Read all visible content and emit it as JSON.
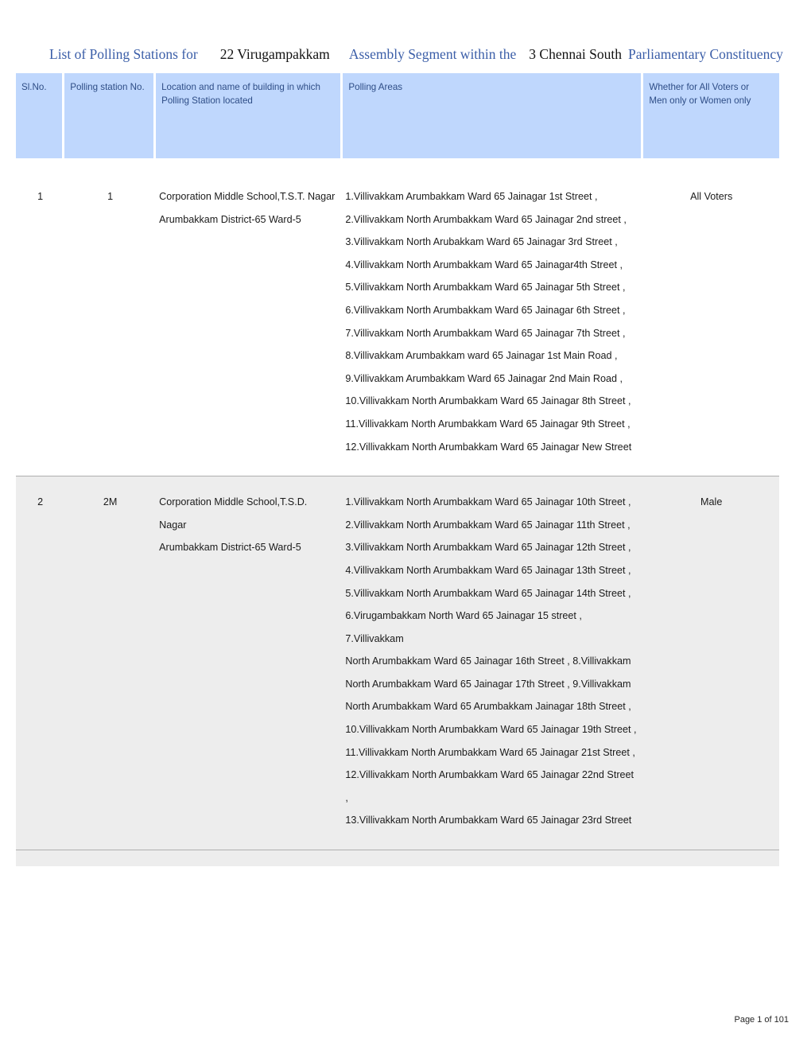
{
  "document": {
    "title_parts": [
      {
        "text": "List of Polling Stations for",
        "color": "#3B5EA8"
      },
      {
        "text": "22 Virugampakkam",
        "color": "#121212"
      },
      {
        "text": "Assembly Segment within the",
        "color": "#3B5EA8"
      },
      {
        "text": "3 Chennai South",
        "color": "#121212"
      },
      {
        "text": "Parliamentary Constituency",
        "color": "#3B5EA8"
      }
    ],
    "title_segment_1": "List of Polling Stations for",
    "title_segment_2": "22 Virugampakkam",
    "title_segment_3": "Assembly Segment within the",
    "title_segment_4": "3 Chennai South",
    "title_segment_5": "Parliamentary Constituency",
    "footer": "Page 1 of 101",
    "colors": {
      "header_background": "#BFD7FD",
      "header_text": "#2E4D86",
      "title_accent": "#3B5EA8",
      "alt_row_background": "#EDEDED",
      "separator": "#AFAFAF"
    }
  },
  "table": {
    "columns": [
      {
        "key": "sl_no",
        "label": "Sl.No."
      },
      {
        "key": "station_no",
        "label": "Polling station No."
      },
      {
        "key": "location",
        "label": "Location and name of building in which Polling Station located"
      },
      {
        "key": "polling_areas",
        "label": "Polling Areas"
      },
      {
        "key": "voters",
        "label": "Whether for All Voters or Men only or Women only"
      }
    ],
    "column_header_lines": {
      "sl_no": [
        "Sl.No."
      ],
      "station_no": [
        "Polling station No."
      ],
      "location": [
        "Location and name of building in which",
        "Polling Station located"
      ],
      "polling_areas": [
        "Polling Areas"
      ],
      "voters": [
        "Whether for All Voters or",
        "Men only or Women only"
      ]
    },
    "rows": [
      {
        "sl_no": "1",
        "station_no": "1",
        "location_lines": [
          "Corporation Middle School,T.S.T. Nagar",
          "Arumbakkam District-65 Ward-5"
        ],
        "polling_area_lines": [
          "1.Villivakkam Arumbakkam Ward 65 Jainagar 1st Street ,",
          "2.Villivakkam North Arumbakkam Ward 65 Jainagar 2nd street ,",
          "3.Villivakkam North Arubakkam Ward 65 Jainagar 3rd Street ,",
          "4.Villivakkam North Arumbakkam Ward 65 Jainagar4th Street ,",
          "5.Villivakkam North Arumbakkam Ward 65 Jainagar 5th Street ,",
          "6.Villivakkam North Arumbakkam Ward 65 Jainagar 6th Street ,",
          "7.Villivakkam North Arumbakkam Ward 65 Jainagar 7th Street ,",
          "8.Villivakkam Arumbakkam ward 65 Jainagar 1st Main Road ,",
          "9.Villivakkam Arumbakkam Ward 65 Jainagar 2nd Main Road ,",
          "10.Villivakkam North Arumbakkam Ward 65 Jainagar 8th Street ,",
          "11.Villivakkam North Arumbakkam Ward 65 Jainagar 9th Street ,",
          "12.Villivakkam North Arumbakkam Ward 65 Jainagar New Street"
        ],
        "voters": "All Voters",
        "shaded": false
      },
      {
        "sl_no": "2",
        "station_no": "2M",
        "location_lines": [
          "Corporation Middle School,T.S.D. Nagar",
          "Arumbakkam District-65 Ward-5"
        ],
        "polling_area_lines": [
          "1.Villivakkam North Arumbakkam Ward 65 Jainagar 10th Street ,",
          "2.Villivakkam North Arumbakkam Ward 65 Jainagar 11th Street ,",
          "3.Villivakkam North Arumbakkam Ward 65 Jainagar 12th Street ,",
          "4.Villivakkam North Arumbakkam Ward 65 Jainagar 13th Street ,",
          "5.Villivakkam North Arumbakkam Ward 65 Jainagar 14th Street ,",
          "6.Virugambakkam North Ward 65 Jainagar 15 street , 7.Villivakkam",
          "North Arumbakkam Ward 65 Jainagar 16th Street , 8.Villivakkam",
          "North Arumbakkam Ward 65 Jainagar 17th Street , 9.Villivakkam",
          "North Arumbakkam Ward 65 Arumbakkam Jainagar 18th Street ,",
          "10.Villivakkam North Arumbakkam Ward 65 Jainagar 19th Street ,",
          "11.Villivakkam North Arumbakkam Ward 65 Jainagar 21st Street ,",
          "12.Villivakkam North Arumbakkam Ward 65 Jainagar 22nd Street ,",
          "13.Villivakkam North Arumbakkam Ward 65 Jainagar 23rd Street"
        ],
        "voters": "Male",
        "shaded": true
      }
    ]
  }
}
